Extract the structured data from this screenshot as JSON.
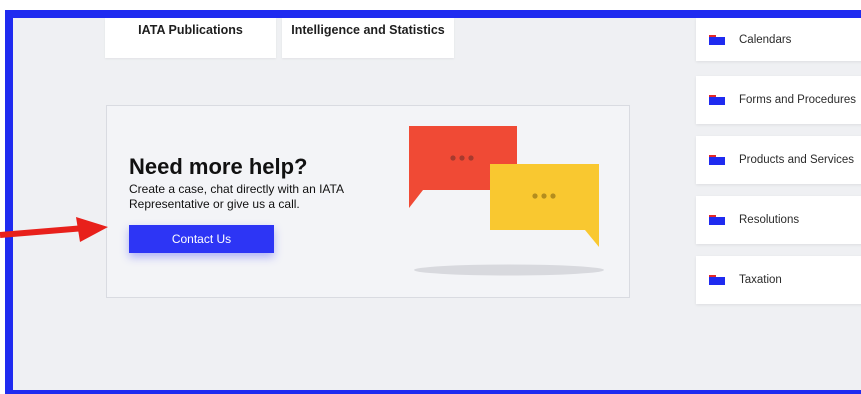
{
  "top_cards": {
    "publications": "IATA Publications",
    "intelligence": "Intelligence and Statistics"
  },
  "help": {
    "title": "Need more help?",
    "description": "Create a case, chat directly with an IATA Representative or give us a call.",
    "button": "Contact Us"
  },
  "sidebar": {
    "items": [
      {
        "label": "Calendars",
        "icon": "folder-icon"
      },
      {
        "label": "Forms and Procedures",
        "icon": "folder-icon"
      },
      {
        "label": "Products and Services",
        "icon": "folder-icon"
      },
      {
        "label": "Resolutions",
        "icon": "folder-icon"
      },
      {
        "label": "Taxation",
        "icon": "folder-icon"
      }
    ]
  },
  "colors": {
    "frame_border": "#1f2bf0",
    "primary_button": "#2d35f5",
    "bubble_red": "#f04a35",
    "bubble_yellow": "#f9c830",
    "annotation_arrow": "#e8201b"
  }
}
